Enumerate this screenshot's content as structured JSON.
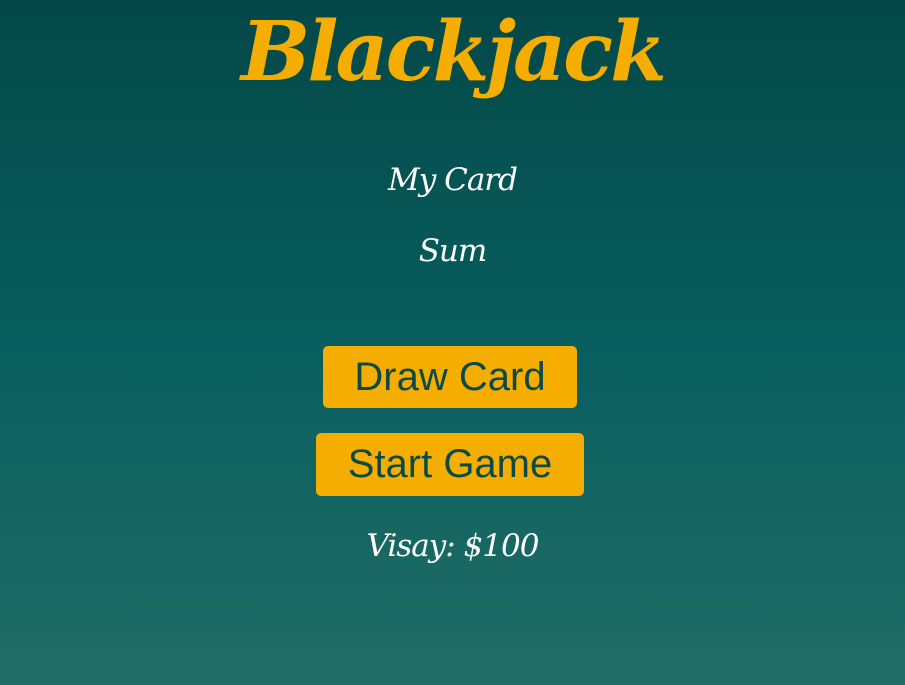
{
  "header": {
    "title": "Blackjack"
  },
  "game": {
    "cards_label": "My Card",
    "sum_label": "Sum",
    "player_label": "Visay: $100"
  },
  "controls": {
    "draw_label": "Draw Card",
    "start_label": "Start Game"
  },
  "colors": {
    "accent": "#f5ad00",
    "background_top": "#044848",
    "background_bottom": "#216d66",
    "button_text": "#0b4a47"
  }
}
